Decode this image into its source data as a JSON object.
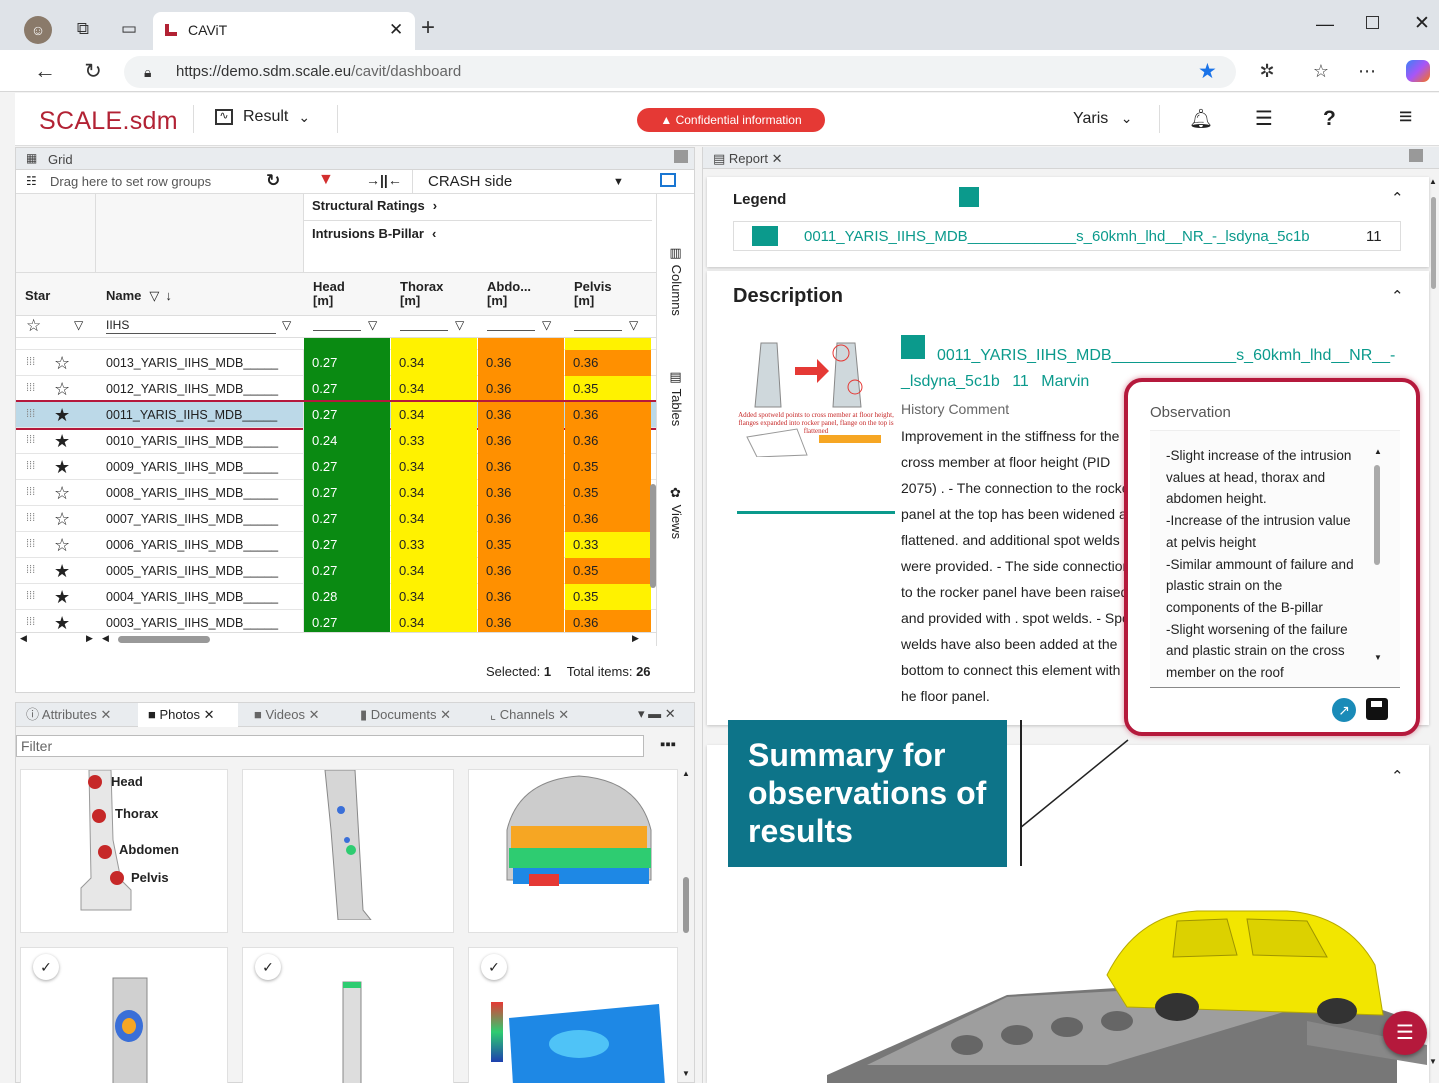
{
  "browser": {
    "tab_title": "CAViT",
    "url_host": "https://demo.sdm.scale.eu",
    "url_path": "/cavit/dashboard"
  },
  "header": {
    "logo": "SCALE.sdm",
    "result": "Result",
    "confidential": "Confidential information",
    "project": "Yaris",
    "help": "?"
  },
  "grid": {
    "panel_title": "Grid",
    "group_hint": "Drag here to set row groups",
    "view_select": "CRASH side",
    "group_structural": "Structural Ratings",
    "group_intrusions": "Intrusions B-Pillar",
    "col_star": "Star",
    "col_name": "Name",
    "col_head": "Head",
    "col_head_unit": "[m]",
    "col_thorax": "Thorax",
    "col_thorax_unit": "[m]",
    "col_abdo": "Abdo...",
    "col_abdo_unit": "[m]",
    "col_pelvis": "Pelvis",
    "col_pelvis_unit": "[m]",
    "name_filter": "IIHS",
    "side_columns": "Columns",
    "side_tables": "Tables",
    "side_views": "Views",
    "rows": [
      {
        "name": "0013_YARIS_IIHS_MDB_____",
        "head": "0.27",
        "thorax": "0.34",
        "abdo": "0.36",
        "pelvis": "0.36",
        "starred": false,
        "pc": "o"
      },
      {
        "name": "0012_YARIS_IIHS_MDB_____",
        "head": "0.27",
        "thorax": "0.34",
        "abdo": "0.36",
        "pelvis": "0.35",
        "starred": false,
        "pc": "y"
      },
      {
        "name": "0011_YARIS_IIHS_MDB_____",
        "head": "0.27",
        "thorax": "0.34",
        "abdo": "0.36",
        "pelvis": "0.36",
        "starred": true,
        "pc": "o",
        "selected": true
      },
      {
        "name": "0010_YARIS_IIHS_MDB_____",
        "head": "0.24",
        "thorax": "0.33",
        "abdo": "0.36",
        "pelvis": "0.36",
        "starred": true,
        "pc": "o"
      },
      {
        "name": "0009_YARIS_IIHS_MDB_____",
        "head": "0.27",
        "thorax": "0.34",
        "abdo": "0.36",
        "pelvis": "0.35",
        "starred": true,
        "pc": "o"
      },
      {
        "name": "0008_YARIS_IIHS_MDB_____",
        "head": "0.27",
        "thorax": "0.34",
        "abdo": "0.36",
        "pelvis": "0.35",
        "starred": false,
        "pc": "o"
      },
      {
        "name": "0007_YARIS_IIHS_MDB_____",
        "head": "0.27",
        "thorax": "0.34",
        "abdo": "0.36",
        "pelvis": "0.36",
        "starred": false,
        "pc": "o"
      },
      {
        "name": "0006_YARIS_IIHS_MDB_____",
        "head": "0.27",
        "thorax": "0.33",
        "abdo": "0.35",
        "pelvis": "0.33",
        "starred": false,
        "pc": "y"
      },
      {
        "name": "0005_YARIS_IIHS_MDB_____",
        "head": "0.27",
        "thorax": "0.34",
        "abdo": "0.36",
        "pelvis": "0.35",
        "starred": true,
        "pc": "o"
      },
      {
        "name": "0004_YARIS_IIHS_MDB_____",
        "head": "0.28",
        "thorax": "0.34",
        "abdo": "0.36",
        "pelvis": "0.35",
        "starred": true,
        "pc": "y"
      },
      {
        "name": "0003_YARIS_IIHS_MDB_____",
        "head": "0.27",
        "thorax": "0.34",
        "abdo": "0.36",
        "pelvis": "0.36",
        "starred": true,
        "pc": "o"
      }
    ],
    "selected_label": "Selected:",
    "selected_count": "1",
    "total_label": "Total items:",
    "total_count": "26"
  },
  "bottom_tabs": {
    "attributes": "Attributes",
    "photos": "Photos",
    "videos": "Videos",
    "documents": "Documents",
    "channels": "Channels",
    "filter_placeholder": "Filter"
  },
  "dummy_labels": {
    "head": "Head",
    "thorax": "Thorax",
    "abdomen": "Abdomen",
    "pelvis": "Pelvis"
  },
  "report": {
    "tab": "Report",
    "legend_title": "Legend",
    "legend_name_a": "0011_YARIS_IIHS_MDB_____________",
    "legend_name_b": "s_60kmh_lhd__NR_-_lsdyna_5c1b",
    "legend_num": "11",
    "description_title": "Description",
    "desc_name_a": "0011_YARIS_IIHS_MDB______________s_60kmh_lhd__NR__-",
    "desc_name_b": "_lsdyna_5c1b",
    "desc_num": "11",
    "desc_user": "Marvin",
    "history_label": "History Comment",
    "history_lines": [
      "Improvement in the stiffness for the",
      "cross member at floor height (PID",
      "2075) . - The connection to the rocker",
      "panel at the top has been widened and",
      "flattened. and additional spot welds",
      "were provided. - The side connections",
      "to the rocker panel have been raised",
      "and provided with . spot welds. - Spot",
      "welds have also been added at the",
      "bottom to connect this element with t",
      "he floor panel."
    ],
    "observation_label": "Observation",
    "observation_lines": [
      "-Slight increase of the intrusion",
      "values at head, thorax and",
      "abdomen height.",
      "-Increase of the intrusion value",
      "at pelvis height",
      "-Similar ammount of failure and",
      "plastic strain on the",
      "components of the B-pillar",
      "-Slight worsening of the failure",
      "and plastic strain on the cross",
      "member on the roof"
    ],
    "thumb_caption": "Added spotweld points to cross member at floor height, flanges expanded into rocker panel, flange on the top is flattened",
    "callout": "Summary for observations of results"
  },
  "colors": {
    "brand": "#b22234",
    "teal": "#0b9a8c",
    "callout": "#0d7489",
    "highlight": "#b5193c"
  }
}
